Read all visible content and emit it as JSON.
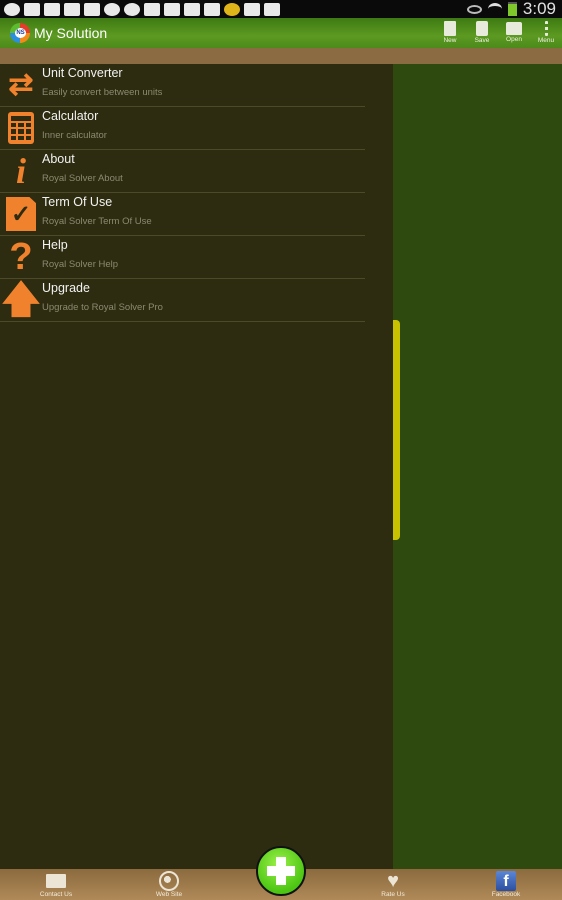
{
  "status_bar": {
    "notification_icons": [
      "hangouts-icon",
      "gmail-icon",
      "gallery-icon",
      "gmail-icon",
      "upload-icon",
      "sync-icon",
      "cloud-upload-icon",
      "flipboard-icon",
      "sd-card-icon",
      "sd-card-icon",
      "sd-card-icon",
      "coin-app-icon",
      "clipboard-check-icon",
      "video-icon"
    ],
    "system_icons": [
      "eye-icon",
      "wifi-icon",
      "battery-icon"
    ],
    "time": "3:09"
  },
  "action_bar": {
    "app_title": "My Solution",
    "logo_text": "NS",
    "actions": [
      {
        "label": "New",
        "icon": "new-document-icon"
      },
      {
        "label": "Save",
        "icon": "save-icon"
      },
      {
        "label": "Open",
        "icon": "open-folder-icon"
      },
      {
        "label": "Menu",
        "icon": "overflow-menu-icon"
      }
    ]
  },
  "drawer": {
    "items": [
      {
        "title": "Unit Converter",
        "subtitle": "Easily convert between units",
        "icon": "convert-arrows-icon"
      },
      {
        "title": "Calculator",
        "subtitle": "Inner calculator",
        "icon": "calculator-icon"
      },
      {
        "title": "About",
        "subtitle": "Royal Solver About",
        "icon": "info-icon"
      },
      {
        "title": "Term Of Use",
        "subtitle": "Royal Solver Term Of Use",
        "icon": "checked-document-icon"
      },
      {
        "title": "Help",
        "subtitle": "Royal Solver Help",
        "icon": "question-icon"
      },
      {
        "title": "Upgrade",
        "subtitle": "Upgrade to Royal Solver Pro",
        "icon": "arrow-up-icon"
      }
    ]
  },
  "bottom_bar": {
    "items": [
      {
        "label": "Contact Us",
        "icon": "envelope-icon"
      },
      {
        "label": "Web Site",
        "icon": "globe-icon"
      },
      {
        "label": "Rate Us",
        "icon": "heart-icon"
      },
      {
        "label": "Facebook",
        "icon": "facebook-icon"
      }
    ],
    "fab_icon": "plus-icon",
    "facebook_glyph": "f"
  },
  "colors": {
    "accent_orange": "#f0822e",
    "action_bar_green": "#5c9a22",
    "drawer_bg": "#2d2c10",
    "content_bg": "#2e4a0e",
    "handle_yellow": "#c9c200",
    "bottom_bar_brown": "#a07c4c",
    "fab_green": "#4cc612"
  }
}
